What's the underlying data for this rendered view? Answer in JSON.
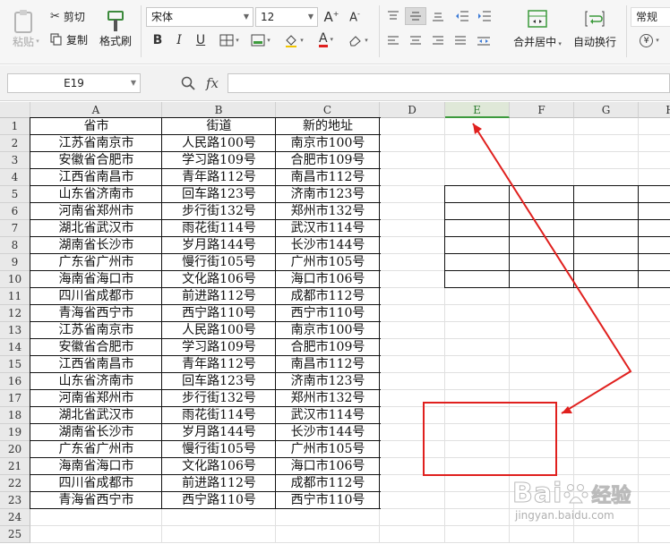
{
  "ribbon": {
    "paste_label": "粘贴",
    "cut_label": "剪切",
    "copy_label": "复制",
    "format_painter_label": "格式刷",
    "font_name": "宋体",
    "font_size": "12",
    "bold": "B",
    "italic": "I",
    "underline": "U",
    "font_color_glyph": "A",
    "merge_center_label": "合并居中",
    "wrap_text_label": "自动换行",
    "number_format": "常规",
    "currency_glyph": "¥"
  },
  "formula_bar": {
    "cell_ref": "E19",
    "fx_label": "fx",
    "value": ""
  },
  "sheet": {
    "columns": [
      "A",
      "B",
      "C",
      "D",
      "E",
      "F",
      "G",
      "H"
    ],
    "rows": [
      "1",
      "2",
      "3",
      "4",
      "5",
      "6",
      "7",
      "8",
      "9",
      "10",
      "11",
      "12",
      "13",
      "14",
      "15",
      "16",
      "17",
      "18",
      "19",
      "20",
      "21",
      "22",
      "23",
      "24",
      "25"
    ],
    "headers": [
      "省市",
      "街道",
      "新的地址"
    ],
    "data": [
      [
        "江苏省南京市",
        "人民路100号",
        "南京市100号"
      ],
      [
        "安徽省合肥市",
        "学习路109号",
        "合肥市109号"
      ],
      [
        "江西省南昌市",
        "青年路112号",
        "南昌市112号"
      ],
      [
        "山东省济南市",
        "回车路123号",
        "济南市123号"
      ],
      [
        "河南省郑州市",
        "步行街132号",
        "郑州市132号"
      ],
      [
        "湖北省武汉市",
        "雨花街114号",
        "武汉市114号"
      ],
      [
        "湖南省长沙市",
        "岁月路144号",
        "长沙市144号"
      ],
      [
        "广东省广州市",
        "慢行街105号",
        "广州市105号"
      ],
      [
        "海南省海口市",
        "文化路106号",
        "海口市106号"
      ],
      [
        "四川省成都市",
        "前进路112号",
        "成都市112号"
      ],
      [
        "青海省西宁市",
        "西宁路110号",
        "西宁市110号"
      ],
      [
        "江苏省南京市",
        "人民路100号",
        "南京市100号"
      ],
      [
        "安徽省合肥市",
        "学习路109号",
        "合肥市109号"
      ],
      [
        "江西省南昌市",
        "青年路112号",
        "南昌市112号"
      ],
      [
        "山东省济南市",
        "回车路123号",
        "济南市123号"
      ],
      [
        "河南省郑州市",
        "步行街132号",
        "郑州市132号"
      ],
      [
        "湖北省武汉市",
        "雨花街114号",
        "武汉市114号"
      ],
      [
        "湖南省长沙市",
        "岁月路144号",
        "长沙市144号"
      ],
      [
        "广东省广州市",
        "慢行街105号",
        "广州市105号"
      ],
      [
        "海南省海口市",
        "文化路106号",
        "海口市106号"
      ],
      [
        "四川省成都市",
        "前进路112号",
        "成都市112号"
      ],
      [
        "青海省西宁市",
        "西宁路110号",
        "西宁市110号"
      ]
    ],
    "selected_column": "E"
  },
  "watermark": {
    "brand": "Bai",
    "brand_suffix": "经验",
    "url": "jingyan.baidu.com"
  },
  "colors": {
    "accent_green": "#3c9a3c",
    "annotation_red": "#e0201e"
  }
}
